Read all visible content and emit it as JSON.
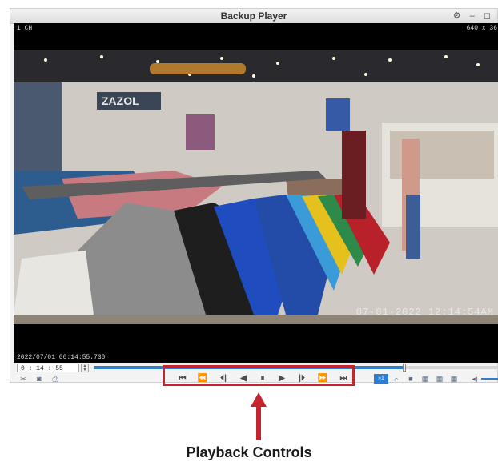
{
  "window": {
    "title": "Backup Player",
    "controls": "⚙ – ◻"
  },
  "video": {
    "channel": "1 CH",
    "resolution": "640 x 36",
    "osd_datetime": "07-01-2022  12:14:54AM",
    "record_timestamp": "2022/07/01 00:14:55.730"
  },
  "timeline": {
    "time_value": "0 : 14 : 55",
    "spin_up": "▲",
    "spin_down": "▼",
    "progress": 0.77
  },
  "toolbar": {
    "left_icons": [
      "scissors-icon",
      "camera-icon",
      "printer-icon"
    ],
    "playback_controls": [
      {
        "name": "jump-start",
        "glyph": "⏮"
      },
      {
        "name": "fast-rewind",
        "glyph": "⏪"
      },
      {
        "name": "step-back",
        "glyph": "⏴|"
      },
      {
        "name": "reverse-play",
        "glyph": "◀"
      },
      {
        "name": "pause",
        "glyph": "⏸"
      },
      {
        "name": "play",
        "glyph": "▶"
      },
      {
        "name": "step-forward",
        "glyph": "|⏵"
      },
      {
        "name": "fast-forward",
        "glyph": "⏩"
      },
      {
        "name": "jump-end",
        "glyph": "⏭"
      }
    ],
    "speed_label": "»1",
    "right_icons": [
      "zoom-icon",
      "layout-1-icon",
      "layout-4-icon",
      "layout-9-icon",
      "layout-16-icon",
      "volume-icon"
    ],
    "accent_color": "#2d7ed0"
  },
  "annotation": {
    "label": "Playback Controls",
    "color": "#c4242d"
  }
}
